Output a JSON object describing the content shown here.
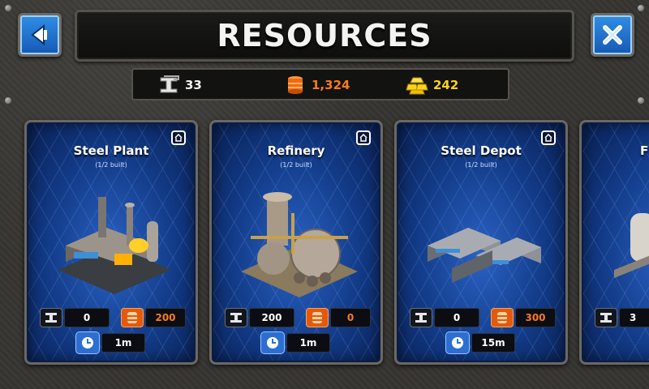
{
  "header": {
    "title": "RESOURCES"
  },
  "nav": {
    "back_icon": "back-arrow-icon",
    "close_icon": "close-x-icon"
  },
  "totals": {
    "steel": "33",
    "oil": "1,324",
    "gold": "242"
  },
  "colors": {
    "steel": "#f2f2f2",
    "oil": "#ff7a1a",
    "gold": "#ffd21a",
    "accent": "#2f8ee6"
  },
  "cards": [
    {
      "name": "Steel Plant",
      "built": "(1/2 built)",
      "steel": "0",
      "oil": "200",
      "time": "1m",
      "art_icon": "steel-plant-building-icon"
    },
    {
      "name": "Refinery",
      "built": "(1/2 built)",
      "steel": "200",
      "oil": "0",
      "time": "1m",
      "art_icon": "refinery-building-icon"
    },
    {
      "name": "Steel Depot",
      "built": "(1/2 built)",
      "steel": "0",
      "oil": "300",
      "time": "15m",
      "art_icon": "steel-depot-building-icon"
    },
    {
      "name": "F",
      "built": "",
      "steel": "3",
      "oil": "",
      "time": "",
      "art_icon": "partial-building-icon"
    }
  ]
}
